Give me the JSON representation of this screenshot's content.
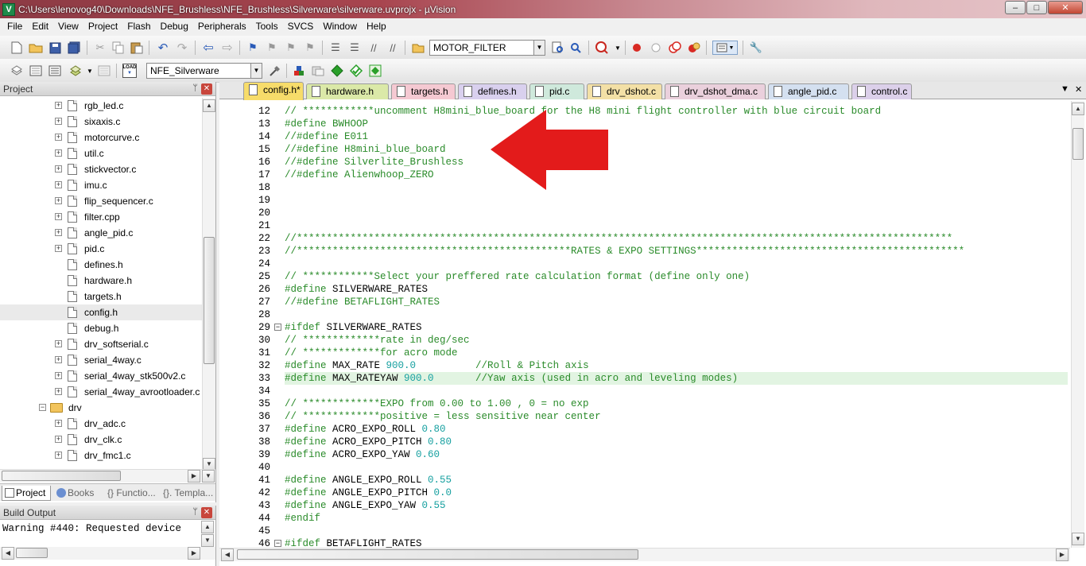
{
  "window": {
    "title": "C:\\Users\\lenovog40\\Downloads\\NFE_Brushless\\NFE_Brushless\\Silverware\\silverware.uvprojx - µVision",
    "app_icon": "uvision-icon",
    "controls": {
      "minimize": "–",
      "maximize": "□",
      "close": "✕"
    }
  },
  "menu": [
    "File",
    "Edit",
    "View",
    "Project",
    "Flash",
    "Debug",
    "Peripherals",
    "Tools",
    "SVCS",
    "Window",
    "Help"
  ],
  "toolbar1": {
    "find_combo": "MOTOR_FILTER"
  },
  "toolbar2": {
    "target_combo": "NFE_Silverware",
    "load_label": "LOAD"
  },
  "project_panel": {
    "title": "Project",
    "pin": "ᛘ",
    "close": "✕",
    "tree": [
      {
        "label": "rgb_led.c",
        "type": "file",
        "expandable": true
      },
      {
        "label": "sixaxis.c",
        "type": "file",
        "expandable": true
      },
      {
        "label": "motorcurve.c",
        "type": "file",
        "expandable": true
      },
      {
        "label": "util.c",
        "type": "file",
        "expandable": true
      },
      {
        "label": "stickvector.c",
        "type": "file",
        "expandable": true
      },
      {
        "label": "imu.c",
        "type": "file",
        "expandable": true
      },
      {
        "label": "flip_sequencer.c",
        "type": "file",
        "expandable": true
      },
      {
        "label": "filter.cpp",
        "type": "file",
        "expandable": true
      },
      {
        "label": "angle_pid.c",
        "type": "file",
        "expandable": true
      },
      {
        "label": "pid.c",
        "type": "file",
        "expandable": true
      },
      {
        "label": "defines.h",
        "type": "file",
        "expandable": false
      },
      {
        "label": "hardware.h",
        "type": "file",
        "expandable": false
      },
      {
        "label": "targets.h",
        "type": "file",
        "expandable": false
      },
      {
        "label": "config.h",
        "type": "file",
        "expandable": false,
        "selected": true
      },
      {
        "label": "debug.h",
        "type": "file",
        "expandable": false
      },
      {
        "label": "drv_softserial.c",
        "type": "file",
        "expandable": true
      },
      {
        "label": "serial_4way.c",
        "type": "file",
        "expandable": true
      },
      {
        "label": "serial_4way_stk500v2.c",
        "type": "file",
        "expandable": true
      },
      {
        "label": "serial_4way_avrootloader.c",
        "type": "file",
        "expandable": true
      },
      {
        "label": "drv",
        "type": "folder",
        "expandable": true
      },
      {
        "label": "drv_adc.c",
        "type": "file",
        "expandable": true
      },
      {
        "label": "drv_clk.c",
        "type": "file",
        "expandable": true
      },
      {
        "label": "drv_fmc1.c",
        "type": "file",
        "expandable": true
      }
    ],
    "tabs": [
      "Project",
      "Books",
      "{} Functio...",
      "{}. Templa..."
    ]
  },
  "build_output": {
    "title": "Build Output",
    "pin": "ᛘ",
    "close": "✕",
    "text": "Warning #440: Requested device"
  },
  "editor": {
    "tabs": [
      {
        "label": "config.h*",
        "color": "#f7dc6a",
        "active": true
      },
      {
        "label": "hardware.h",
        "color": "#dbe9a8"
      },
      {
        "label": "targets.h",
        "color": "#f5c9d2"
      },
      {
        "label": "defines.h",
        "color": "#d9d0ee"
      },
      {
        "label": "pid.c",
        "color": "#cfe9dc"
      },
      {
        "label": "drv_dshot.c",
        "color": "#f3e0a6"
      },
      {
        "label": "drv_dshot_dma.c",
        "color": "#ead0dc"
      },
      {
        "label": "angle_pid.c",
        "color": "#d4e0f0"
      },
      {
        "label": "control.c",
        "color": "#dcd0ea"
      }
    ],
    "tab_menu": "▼",
    "tab_close": "✕",
    "lines": [
      {
        "n": "12",
        "parts": [
          {
            "t": "c-cmt",
            "s": "// ************uncomment H8mini_blue_board for the H8 mini flight controller with blue circuit board"
          }
        ]
      },
      {
        "n": "13",
        "parts": [
          {
            "t": "c-pp",
            "s": "#define BWHOOP"
          }
        ]
      },
      {
        "n": "14",
        "parts": [
          {
            "t": "c-cmt",
            "s": "//#define E011"
          }
        ]
      },
      {
        "n": "15",
        "parts": [
          {
            "t": "c-cmt",
            "s": "//#define H8mini_blue_board"
          }
        ]
      },
      {
        "n": "16",
        "parts": [
          {
            "t": "c-cmt",
            "s": "//#define Silverlite_Brushless"
          }
        ]
      },
      {
        "n": "17",
        "parts": [
          {
            "t": "c-cmt",
            "s": "//#define Alienwhoop_ZERO"
          }
        ]
      },
      {
        "n": "18",
        "parts": []
      },
      {
        "n": "19",
        "parts": []
      },
      {
        "n": "20",
        "parts": []
      },
      {
        "n": "21",
        "parts": []
      },
      {
        "n": "22",
        "parts": [
          {
            "t": "c-cmt",
            "s": "//**************************************************************************************************************"
          }
        ]
      },
      {
        "n": "23",
        "parts": [
          {
            "t": "c-cmt",
            "s": "//**********************************************RATES & EXPO SETTINGS*********************************************"
          }
        ]
      },
      {
        "n": "24",
        "parts": []
      },
      {
        "n": "25",
        "parts": [
          {
            "t": "c-cmt",
            "s": "// ************Select your preffered rate calculation format (define only one)"
          }
        ]
      },
      {
        "n": "26",
        "parts": [
          {
            "t": "c-pp",
            "s": "#define "
          },
          {
            "t": "c-txt",
            "s": "SILVERWARE_RATES"
          }
        ]
      },
      {
        "n": "27",
        "parts": [
          {
            "t": "c-cmt",
            "s": "//#define BETAFLIGHT_RATES"
          }
        ]
      },
      {
        "n": "28",
        "parts": []
      },
      {
        "n": "29",
        "fold": "−",
        "parts": [
          {
            "t": "c-pp",
            "s": "#ifdef "
          },
          {
            "t": "c-txt",
            "s": "SILVERWARE_RATES"
          }
        ]
      },
      {
        "n": "30",
        "parts": [
          {
            "t": "c-cmt",
            "s": "// *************rate in deg/sec"
          }
        ]
      },
      {
        "n": "31",
        "parts": [
          {
            "t": "c-cmt",
            "s": "// *************for acro mode"
          }
        ]
      },
      {
        "n": "32",
        "parts": [
          {
            "t": "c-pp",
            "s": "#define "
          },
          {
            "t": "c-txt",
            "s": "MAX_RATE "
          },
          {
            "t": "c-num",
            "s": "900.0"
          },
          {
            "t": "c-cmt",
            "s": "          //Roll & Pitch axis"
          }
        ]
      },
      {
        "n": "33",
        "highlight": true,
        "parts": [
          {
            "t": "c-pp",
            "s": "#define "
          },
          {
            "t": "c-txt",
            "s": "MAX_RATEYAW "
          },
          {
            "t": "c-num",
            "s": "900.0"
          },
          {
            "t": "c-cmt",
            "s": "       //Yaw axis (used in acro and leveling modes)"
          }
        ]
      },
      {
        "n": "34",
        "parts": []
      },
      {
        "n": "35",
        "parts": [
          {
            "t": "c-cmt",
            "s": "// *************EXPO from 0.00 to 1.00 , 0 = no exp"
          }
        ]
      },
      {
        "n": "36",
        "parts": [
          {
            "t": "c-cmt",
            "s": "// *************positive = less sensitive near center"
          }
        ]
      },
      {
        "n": "37",
        "parts": [
          {
            "t": "c-pp",
            "s": "#define "
          },
          {
            "t": "c-txt",
            "s": "ACRO_EXPO_ROLL "
          },
          {
            "t": "c-num",
            "s": "0.80"
          }
        ]
      },
      {
        "n": "38",
        "parts": [
          {
            "t": "c-pp",
            "s": "#define "
          },
          {
            "t": "c-txt",
            "s": "ACRO_EXPO_PITCH "
          },
          {
            "t": "c-num",
            "s": "0.80"
          }
        ]
      },
      {
        "n": "39",
        "parts": [
          {
            "t": "c-pp",
            "s": "#define "
          },
          {
            "t": "c-txt",
            "s": "ACRO_EXPO_YAW "
          },
          {
            "t": "c-num",
            "s": "0.60"
          }
        ]
      },
      {
        "n": "40",
        "parts": []
      },
      {
        "n": "41",
        "parts": [
          {
            "t": "c-pp",
            "s": "#define "
          },
          {
            "t": "c-txt",
            "s": "ANGLE_EXPO_ROLL "
          },
          {
            "t": "c-num",
            "s": "0.55"
          }
        ]
      },
      {
        "n": "42",
        "parts": [
          {
            "t": "c-pp",
            "s": "#define "
          },
          {
            "t": "c-txt",
            "s": "ANGLE_EXPO_PITCH "
          },
          {
            "t": "c-num",
            "s": "0.0"
          }
        ]
      },
      {
        "n": "43",
        "parts": [
          {
            "t": "c-pp",
            "s": "#define "
          },
          {
            "t": "c-txt",
            "s": "ANGLE_EXPO_YAW "
          },
          {
            "t": "c-num",
            "s": "0.55"
          }
        ]
      },
      {
        "n": "44",
        "parts": [
          {
            "t": "c-pp",
            "s": "#endif"
          }
        ]
      },
      {
        "n": "45",
        "parts": []
      },
      {
        "n": "46",
        "fold": "−",
        "parts": [
          {
            "t": "c-pp",
            "s": "#ifdef "
          },
          {
            "t": "c-txt",
            "s": "BETAFLIGHT_RATES"
          }
        ]
      }
    ]
  },
  "annotation": {
    "arrow_color": "#e31b1b",
    "arrow_icon": "red-arrow-annotation"
  }
}
